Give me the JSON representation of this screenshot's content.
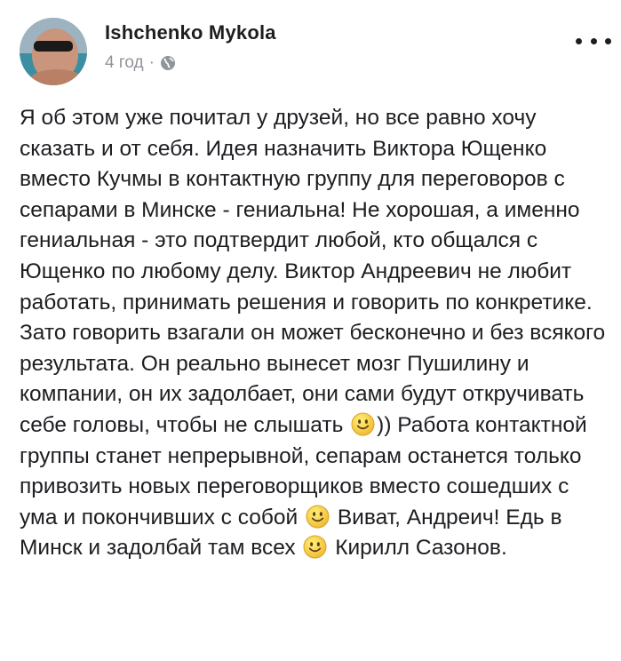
{
  "post": {
    "author": "Ishchenko Mykola",
    "time": "4 год",
    "separator": "·",
    "privacy_icon": "globe-icon",
    "more_icon": "more-options-icon",
    "segments": [
      {
        "type": "text",
        "value": "Я об этом уже почитал у друзей, но все равно хочу сказать и от себя. Идея назначить Виктора Ющенко вместо Кучмы в контактную группу для переговоров с сепарами в Минске - гениальна! Не хорошая, а именно гениальная - это подтвердит любой, кто общался с Ющенко по любому делу. Виктор Андреевич не любит работать, принимать решения и говорить по конкретике. Зато говорить взагали он может бесконечно и без всякого результата. Он реально вынесет мозг Пушилину и компании, он их задолбает, они сами будут откручивать себе головы, чтобы не слышать "
      },
      {
        "type": "emoji",
        "value": "smiley-emoji"
      },
      {
        "type": "text",
        "value": ")) Работа контактной группы станет непрерывной, сепарам останется только привозить новых переговорщиков вместо сошедших с ума и покончивших с собой "
      },
      {
        "type": "emoji",
        "value": "smiley-emoji"
      },
      {
        "type": "text",
        "value": " Виват, Андреич! Едь в Минск и задолбай там всех "
      },
      {
        "type": "emoji",
        "value": "smiley-emoji"
      },
      {
        "type": "text",
        "value": " Кирилл Сазонов."
      }
    ]
  }
}
